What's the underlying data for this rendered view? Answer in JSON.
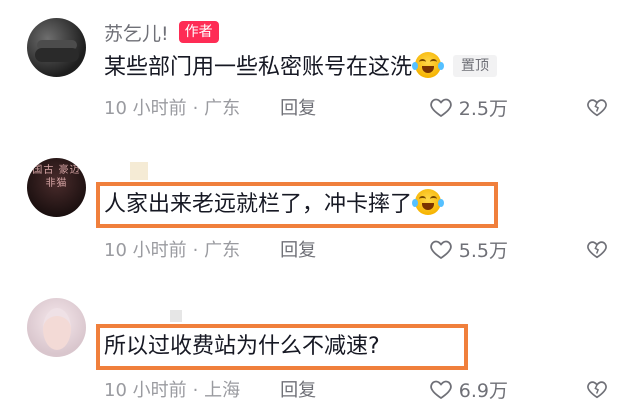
{
  "comments": [
    {
      "username": "苏乞儿!",
      "author_badge": "作者",
      "text": "某些部门用一些私密账号在这洗",
      "pin_label": "置顶",
      "time": "10 小时前",
      "location": "· 广东",
      "reply_label": "回复",
      "likes": "2.5万",
      "avatar": "motorcycle-rider"
    },
    {
      "username": "",
      "text": "人家出来老远就栏了，冲卡摔了",
      "time": "10 小时前",
      "location": "· 广东",
      "reply_label": "回复",
      "likes": "5.5万",
      "avatar": "calligraphy"
    },
    {
      "username": "",
      "text": "所以过收费站为什么不减速?",
      "time": "10 小时前",
      "location": "· 上海",
      "reply_label": "回复",
      "likes": "6.9万",
      "avatar": "portrait"
    }
  ],
  "avatar_glyphs": "国古 豪迈 非猫 ",
  "highlight_color": "#f07f3c",
  "badge_color": "#fe2c55",
  "icons": {
    "like": "heart-outline-icon",
    "dislike": "broken-heart-icon",
    "emoji": "laughing-tears-emoji"
  }
}
